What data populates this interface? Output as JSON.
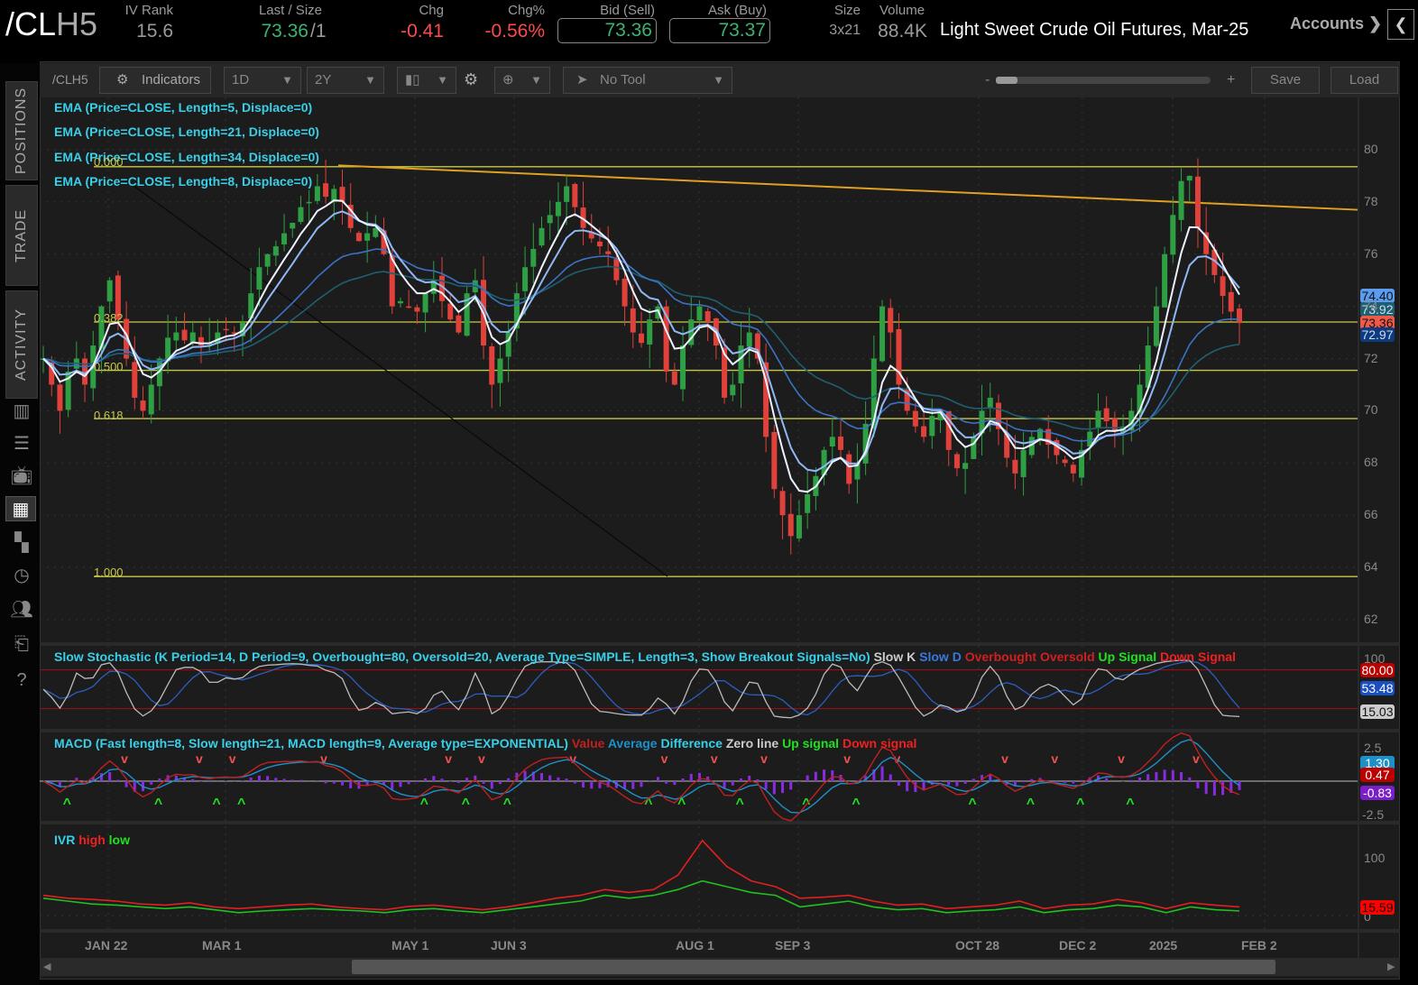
{
  "header": {
    "symbol_main": "/CL",
    "symbol_suffix": "H5",
    "iv_rank_label": "IV Rank",
    "iv_rank": "15.6",
    "last_label": "Last / Size",
    "last": "73.36",
    "size_sep": "/1",
    "chg_label": "Chg",
    "chg": "-0.41",
    "chgpct_label": "Chg%",
    "chgpct": "-0.56%",
    "bid_label": "Bid (Sell)",
    "bid": "73.36",
    "ask_label": "Ask (Buy)",
    "ask": "73.37",
    "size_label": "Size",
    "size": "3x21",
    "volume_label": "Volume",
    "volume": "88.4K",
    "title": "Light Sweet Crude Oil Futures, Mar-25",
    "accounts": "Accounts ❯",
    "collapse": "❮"
  },
  "sidebar": {
    "tabs": [
      "POSITIONS",
      "TRADE",
      "ACTIVITY"
    ]
  },
  "toolbar": {
    "symbol": "/CLH5",
    "indicators": "Indicators",
    "aggregation": "1D",
    "timeframe": "2Y",
    "tool": "No Tool",
    "zoom_minus": "-",
    "zoom_plus": "+",
    "save": "Save",
    "load": "Load"
  },
  "colors": {
    "up": "#2ea043",
    "down": "#e0413a",
    "ema5": "#eef3ff",
    "ema8": "#8fb8f5",
    "ema21": "#3b73c4",
    "ema34": "#1e6070",
    "fib": "#c8c84a",
    "trend": "#e0a020"
  },
  "legends": {
    "ema5": "EMA (Price=CLOSE, Length=5, Displace=0)",
    "ema21": "EMA (Price=CLOSE, Length=21, Displace=0)",
    "ema34": "EMA (Price=CLOSE, Length=34, Displace=0)",
    "ema8": "EMA (Price=CLOSE, Length=8, Displace=0)",
    "stoch": "Slow Stochastic (K Period=14, D Period=9, Overbought=80, Oversold=20, Average Type=SIMPLE, Length=3, Show Breakout Signals=No)",
    "stoch_items": [
      "Slow K",
      "Slow D",
      "Overbought",
      "Oversold",
      "Up Signal",
      "Down Signal"
    ],
    "macd": "MACD (Fast length=8, Slow length=21, MACD length=9, Average type=EXPONENTIAL)",
    "macd_items": [
      "Value",
      "Average",
      "Difference",
      "Zero line",
      "Up signal",
      "Down signal"
    ],
    "ivr": "IVR",
    "ivr_items": [
      "high",
      "low"
    ]
  },
  "fib_levels": [
    "0.000",
    "0.382",
    "0.500",
    "0.618",
    "1.000"
  ],
  "chart_data": {
    "type": "candlestick",
    "price_ticks": [
      "80",
      "78",
      "76",
      "74",
      "72",
      "70",
      "68",
      "66",
      "64",
      "62"
    ],
    "price_tags": {
      "ema5": "74.40",
      "ema8": "73.92",
      "last": "73.36",
      "ema21": "72.97"
    },
    "stoch_ticks": [
      "100"
    ],
    "stoch_tags": {
      "overbought": "80.00",
      "d": "53.48",
      "k": "15.03"
    },
    "macd_ticks": [
      "2.5",
      "-2.5"
    ],
    "macd_tags": {
      "avg": "1.30",
      "value": "0.47",
      "diff": "-0.83"
    },
    "ivr_ticks": [
      "100",
      "0"
    ],
    "ivr_tag": "15.59",
    "x_labels": [
      "JAN 22",
      "MAR 1",
      "MAY 1",
      "JUN 3",
      "AUG 1",
      "SEP 3",
      "OCT 28",
      "DEC 2",
      "2025",
      "FEB 2"
    ],
    "closes": [
      72,
      71,
      70,
      71.5,
      72,
      71,
      72.5,
      74,
      75,
      73.5,
      72,
      70.5,
      70,
      71,
      72,
      72.8,
      73,
      72.7,
      73,
      72.5,
      72.6,
      73,
      73.1,
      73,
      73.4,
      74.5,
      75.5,
      76,
      76.3,
      76.8,
      77.2,
      77.8,
      78,
      78.6,
      78.2,
      78.5,
      78,
      77,
      76.5,
      76.8,
      77,
      76,
      74,
      74.2,
      74,
      73.8,
      74.5,
      75,
      74.2,
      73.5,
      73,
      74.5,
      75,
      72.5,
      71,
      72,
      73,
      74.5,
      75.5,
      76.2,
      77,
      77.5,
      78,
      78.6,
      77.8,
      77,
      76.6,
      76.3,
      76,
      75,
      74,
      73,
      72.6,
      73.5,
      74,
      71.5,
      71,
      72.5,
      73.5,
      74,
      73.4,
      72.5,
      70.5,
      71,
      72.5,
      73,
      72,
      69,
      67,
      66,
      65.2,
      66,
      66.8,
      67.5,
      68.5,
      69,
      68.5,
      67.2,
      68,
      69.5,
      72,
      74,
      73,
      71,
      70,
      69.4,
      69,
      69.8,
      70,
      68.5,
      67.8,
      68,
      69,
      70,
      70.5,
      69.3,
      68.2,
      67.6,
      68.5,
      69,
      69.3,
      68.7,
      68.3,
      68,
      67.6,
      68.5,
      69.2,
      70,
      69.6,
      69.2,
      69.4,
      70,
      71,
      72.5,
      74,
      76,
      77.5,
      78.8,
      79,
      77,
      76,
      75.2,
      74.4,
      73.8,
      73.36
    ],
    "ivr_high": [
      35,
      30,
      28,
      25,
      20,
      18,
      22,
      15,
      12,
      15,
      18,
      20,
      15,
      12,
      10,
      16,
      18,
      14,
      10,
      15,
      22,
      30,
      35,
      45,
      40,
      45,
      70,
      130,
      85,
      60,
      50,
      30,
      32,
      35,
      25,
      18,
      20,
      12,
      15,
      18,
      25,
      12,
      18,
      20,
      28,
      22,
      12,
      22,
      18,
      15
    ],
    "ivr_low": [
      30,
      25,
      20,
      18,
      15,
      12,
      15,
      10,
      5,
      8,
      10,
      12,
      10,
      8,
      5,
      10,
      12,
      8,
      5,
      10,
      15,
      20,
      25,
      35,
      30,
      35,
      45,
      60,
      50,
      40,
      35,
      15,
      20,
      25,
      15,
      10,
      12,
      5,
      8,
      10,
      15,
      5,
      10,
      12,
      18,
      15,
      5,
      15,
      10,
      8
    ]
  }
}
